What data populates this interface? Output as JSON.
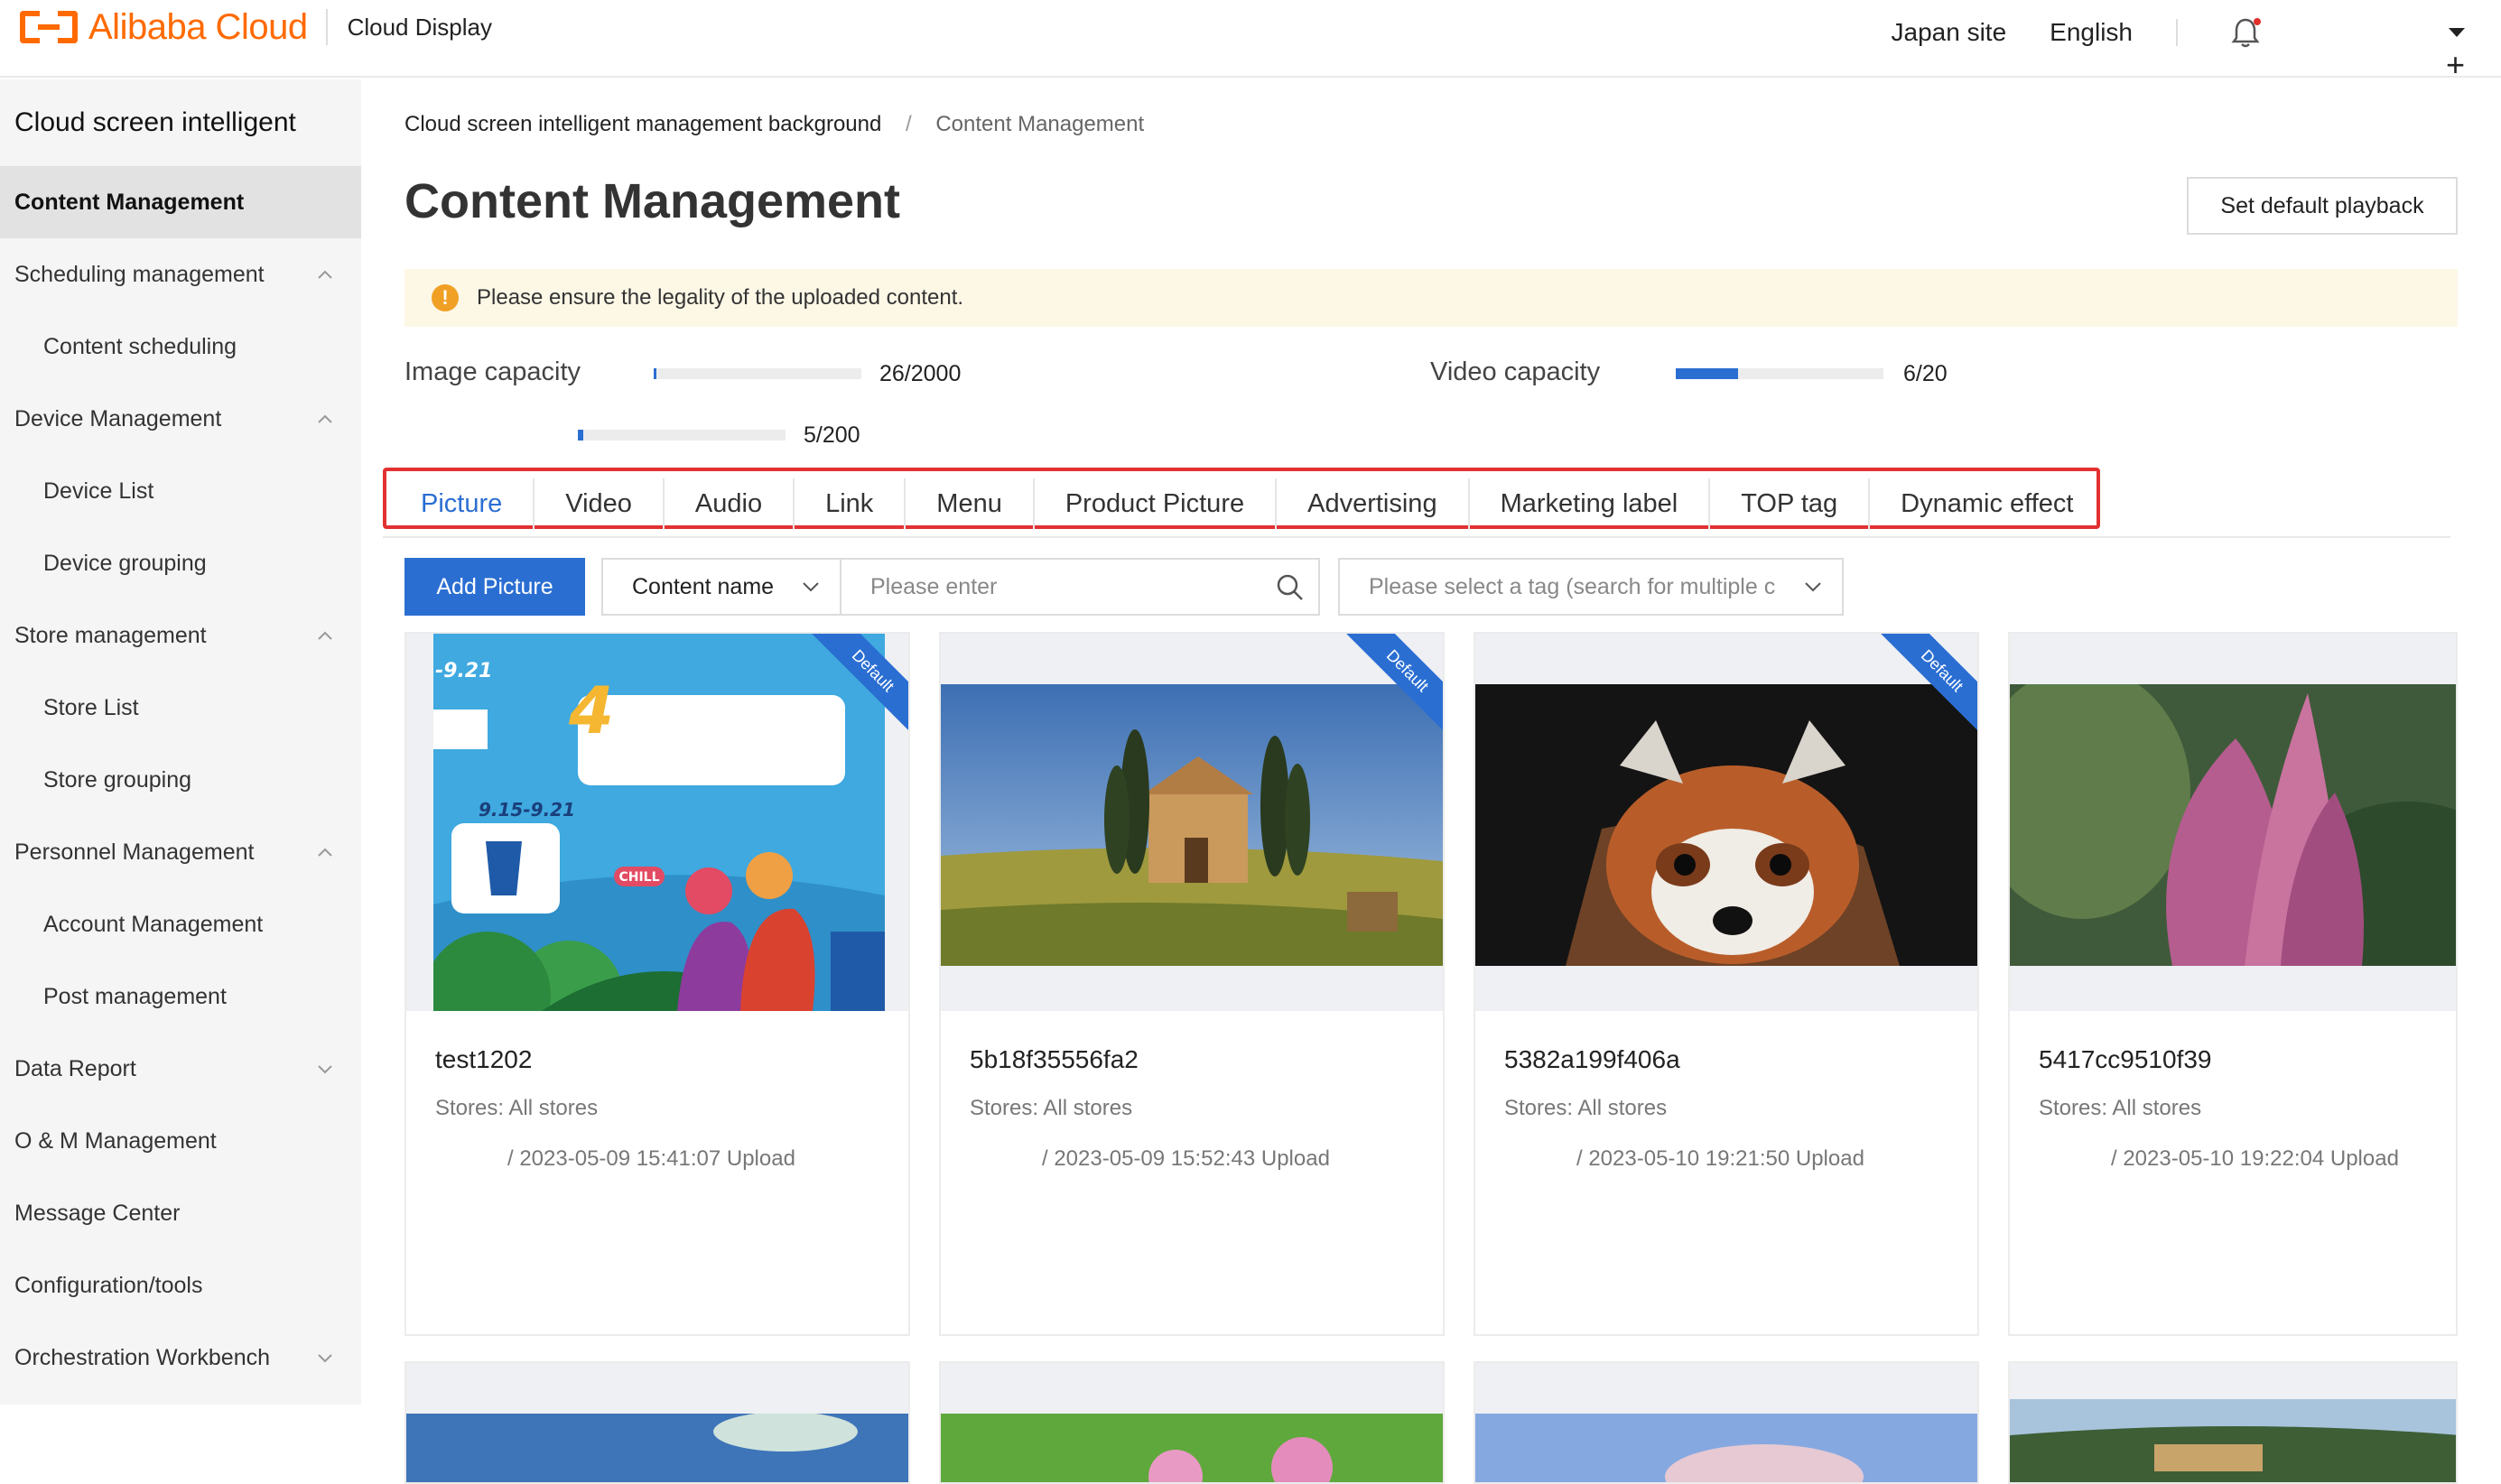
{
  "header": {
    "brand": "Alibaba Cloud",
    "product": "Cloud Display",
    "site": "Japan site",
    "language": "English",
    "plus": "+"
  },
  "sidebar": {
    "title": "Cloud screen intelligent",
    "items": [
      {
        "label": "Content Management"
      },
      {
        "label": "Scheduling management"
      },
      {
        "label": "Content scheduling"
      },
      {
        "label": "Device Management"
      },
      {
        "label": "Device List"
      },
      {
        "label": "Device grouping"
      },
      {
        "label": "Store management"
      },
      {
        "label": "Store List"
      },
      {
        "label": "Store grouping"
      },
      {
        "label": "Personnel Management"
      },
      {
        "label": "Account Management"
      },
      {
        "label": "Post management"
      },
      {
        "label": "Data Report"
      },
      {
        "label": "O & M Management"
      },
      {
        "label": "Message Center"
      },
      {
        "label": "Configuration/tools"
      },
      {
        "label": "Orchestration Workbench"
      }
    ]
  },
  "breadcrumb": {
    "root": "Cloud screen intelligent management background",
    "separator": "/",
    "current": "Content Management"
  },
  "page": {
    "title": "Content Management",
    "default_playback_button": "Set default playback",
    "notice": "Please ensure the legality of the uploaded content.",
    "notice_icon": "!"
  },
  "capacity": {
    "image_label": "Image capacity",
    "image_value": "26/2000",
    "image_fraction": 0.013,
    "video_label": "Video capacity",
    "video_value": "6/20",
    "video_fraction": 0.3,
    "third_value": "5/200",
    "third_fraction": 0.025
  },
  "tabs": [
    {
      "label": "Picture"
    },
    {
      "label": "Video"
    },
    {
      "label": "Audio"
    },
    {
      "label": "Link"
    },
    {
      "label": "Menu"
    },
    {
      "label": "Product Picture"
    },
    {
      "label": "Advertising"
    },
    {
      "label": "Marketing label"
    },
    {
      "label": "TOP tag"
    },
    {
      "label": "Dynamic effect"
    }
  ],
  "filters": {
    "add_button": "Add Picture",
    "field_select": "Content name",
    "search_placeholder": "Please enter",
    "tag_placeholder": "Please select a tag (search for multiple c"
  },
  "cards": [
    {
      "name": "test1202",
      "stores": "Stores: All stores",
      "time": "/ 2023-05-09 15:41:07 Upload",
      "badge": "Default",
      "poster": {
        "date1": "-9.21",
        "num": "4",
        "date2": "9.15-9.21",
        "chill": "CHILL"
      }
    },
    {
      "name": "5b18f35556fa2",
      "stores": "Stores: All stores",
      "time": "/ 2023-05-09 15:52:43 Upload",
      "badge": "Default"
    },
    {
      "name": "5382a199f406a",
      "stores": "Stores: All stores",
      "time": "/ 2023-05-10 19:21:50 Upload",
      "badge": "Default"
    },
    {
      "name": "5417cc9510f39",
      "stores": "Stores: All stores",
      "time": "/ 2023-05-10 19:22:04 Upload"
    }
  ],
  "colors": {
    "accent": "#2a6ed2",
    "brand": "#ff6a00",
    "highlight_box": "#e33131",
    "notice_bg": "#fdf7e6"
  }
}
